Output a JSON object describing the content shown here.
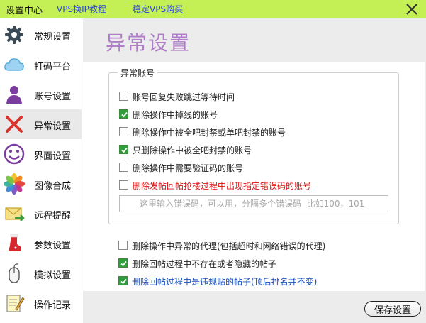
{
  "titlebar": {
    "title": "设置中心",
    "links": [
      "VPS换IP教程",
      "稳定VPS购买"
    ],
    "accent_color": "#c5f055",
    "close_icon": "close-icon"
  },
  "sidebar": {
    "active_index": 3,
    "items": [
      {
        "label": "常规设置",
        "icon": "gear-icon"
      },
      {
        "label": "打码平台",
        "icon": "cloud-icon"
      },
      {
        "label": "账号设置",
        "icon": "user-icon"
      },
      {
        "label": "异常设置",
        "icon": "red-x-icon"
      },
      {
        "label": "界面设置",
        "icon": "smiley-icon"
      },
      {
        "label": "图像合成",
        "icon": "photos-flower-icon"
      },
      {
        "label": "远程提醒",
        "icon": "envelope-arrow-icon"
      },
      {
        "label": "参数设置",
        "icon": "red-boot-icon"
      },
      {
        "label": "模拟设置",
        "icon": "mouse-icon"
      },
      {
        "label": "操作记录",
        "icon": "notepad-icon"
      }
    ]
  },
  "main": {
    "page_title": "异常设置",
    "title_color": "#b07ec8",
    "group": {
      "legend": "异常账号",
      "options": [
        {
          "label": "账号回复失败跳过等待时间",
          "checked": false,
          "color": "normal"
        },
        {
          "label": "删除操作中掉线的账号",
          "checked": true,
          "color": "normal"
        },
        {
          "label": "删除操作中被全吧封禁或单吧封禁的账号",
          "checked": false,
          "color": "normal"
        },
        {
          "label": "只删除操作中被全吧封禁的账号",
          "checked": true,
          "color": "normal"
        },
        {
          "label": "删除操作中需要验证码的账号",
          "checked": false,
          "color": "normal"
        },
        {
          "label": "删除发帖回帖抢楼过程中出现指定错误码的账号",
          "checked": false,
          "color": "red"
        }
      ],
      "error_code_input": {
        "value": "",
        "placeholder": "这里输入错误码，可以用，分隔多个错误码  比如100，101"
      }
    },
    "extra_options": [
      {
        "label": "删除操作中异常的代理(包括超时和网络错误的代理)",
        "checked": false,
        "color": "normal"
      },
      {
        "label": "删除回帖过程中不存在或者隐藏的帖子",
        "checked": true,
        "color": "normal"
      },
      {
        "label": "删除回帖过程中是违规贴的帖子(顶后排名并不变)",
        "checked": true,
        "color": "blue"
      }
    ],
    "save_label": "保存设置"
  }
}
